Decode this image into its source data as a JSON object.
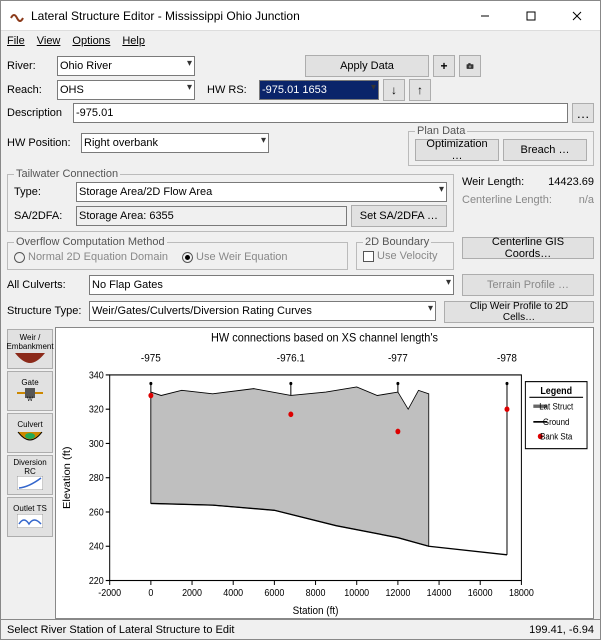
{
  "window": {
    "title": "Lateral Structure Editor - Mississippi Ohio Junction"
  },
  "menu": {
    "file": "File",
    "view": "View",
    "options": "Options",
    "help": "Help"
  },
  "labels": {
    "river": "River:",
    "reach": "Reach:",
    "hw_rs": "HW RS:",
    "description": "Description",
    "hw_position": "HW Position:",
    "plan_data": "Plan Data",
    "tailwater": "Tailwater Connection",
    "type": "Type:",
    "sa2dfa": "SA/2DFA:",
    "weir_length": "Weir Length:",
    "centerline_length": "Centerline Length:",
    "overflow": "Overflow Computation Method",
    "twod_boundary": "2D Boundary",
    "all_culverts": "All Culverts:",
    "structure_type": "Structure Type:"
  },
  "fields": {
    "river": "Ohio River",
    "reach": "OHS",
    "hw_rs": "-975.01   1653",
    "description": "-975.01",
    "hw_position": "Right overbank",
    "tw_type": "Storage Area/2D Flow Area",
    "sa2dfa": "Storage Area: 6355",
    "weir_length": "14423.69",
    "centerline_length": "n/a",
    "all_culverts": "No Flap Gates",
    "structure_type": "Weir/Gates/Culverts/Diversion Rating Curves"
  },
  "buttons": {
    "apply_data": "Apply Data",
    "optimization": "Optimization …",
    "breach": "Breach …",
    "set_sa2dfa": "Set SA/2DFA …",
    "centerline_gis": "Centerline GIS Coords…",
    "terrain_profile": "Terrain Profile …",
    "clip_weir": "Clip Weir Profile to 2D Cells…"
  },
  "radio": {
    "normal_2d": "Normal 2D Equation Domain",
    "use_weir": "Use Weir Equation"
  },
  "checkbox": {
    "use_velocity": "Use Velocity"
  },
  "side": {
    "weir": "Weir / Embankment",
    "gate": "Gate",
    "culvert": "Culvert",
    "diversion": "Diversion RC",
    "outlet": "Outlet TS"
  },
  "status": {
    "left": "Select River Station of Lateral Structure to Edit",
    "right": "199.41, -6.94"
  },
  "chart_data": {
    "type": "line",
    "title": "HW connections based on XS channel length's",
    "xlabel": "Station (ft)",
    "ylabel": "Elevation (ft)",
    "xlim": [
      -2000,
      18000
    ],
    "ylim": [
      220,
      340
    ],
    "xticks": [
      -2000,
      0,
      2000,
      4000,
      6000,
      8000,
      10000,
      12000,
      14000,
      16000,
      18000
    ],
    "yticks": [
      220,
      240,
      260,
      280,
      300,
      320,
      340
    ],
    "hw_markers": [
      {
        "label": "-975",
        "station": 0
      },
      {
        "label": "-976.1",
        "station": 6800
      },
      {
        "label": "-977",
        "station": 12000
      },
      {
        "label": "-978",
        "station": 17300
      }
    ],
    "lat_struct_top": [
      {
        "x": 0,
        "y": 330
      },
      {
        "x": 500,
        "y": 328
      },
      {
        "x": 1500,
        "y": 331
      },
      {
        "x": 3000,
        "y": 329
      },
      {
        "x": 5000,
        "y": 332
      },
      {
        "x": 6800,
        "y": 328
      },
      {
        "x": 8500,
        "y": 330
      },
      {
        "x": 10000,
        "y": 333
      },
      {
        "x": 11000,
        "y": 328
      },
      {
        "x": 12000,
        "y": 330
      },
      {
        "x": 12500,
        "y": 320
      },
      {
        "x": 13000,
        "y": 331
      },
      {
        "x": 13500,
        "y": 329
      }
    ],
    "ground": [
      {
        "x": 0,
        "y": 265
      },
      {
        "x": 3000,
        "y": 264
      },
      {
        "x": 6000,
        "y": 261
      },
      {
        "x": 9000,
        "y": 252
      },
      {
        "x": 12000,
        "y": 245
      },
      {
        "x": 13500,
        "y": 240
      },
      {
        "x": 17300,
        "y": 235
      }
    ],
    "bank_sta": [
      {
        "x": 0,
        "y": 328
      },
      {
        "x": 6800,
        "y": 317
      },
      {
        "x": 12000,
        "y": 307
      },
      {
        "x": 17300,
        "y": 320
      }
    ],
    "legend": {
      "title": "Legend",
      "items": [
        "Lat Struct",
        "Ground",
        "Bank Sta"
      ]
    }
  }
}
